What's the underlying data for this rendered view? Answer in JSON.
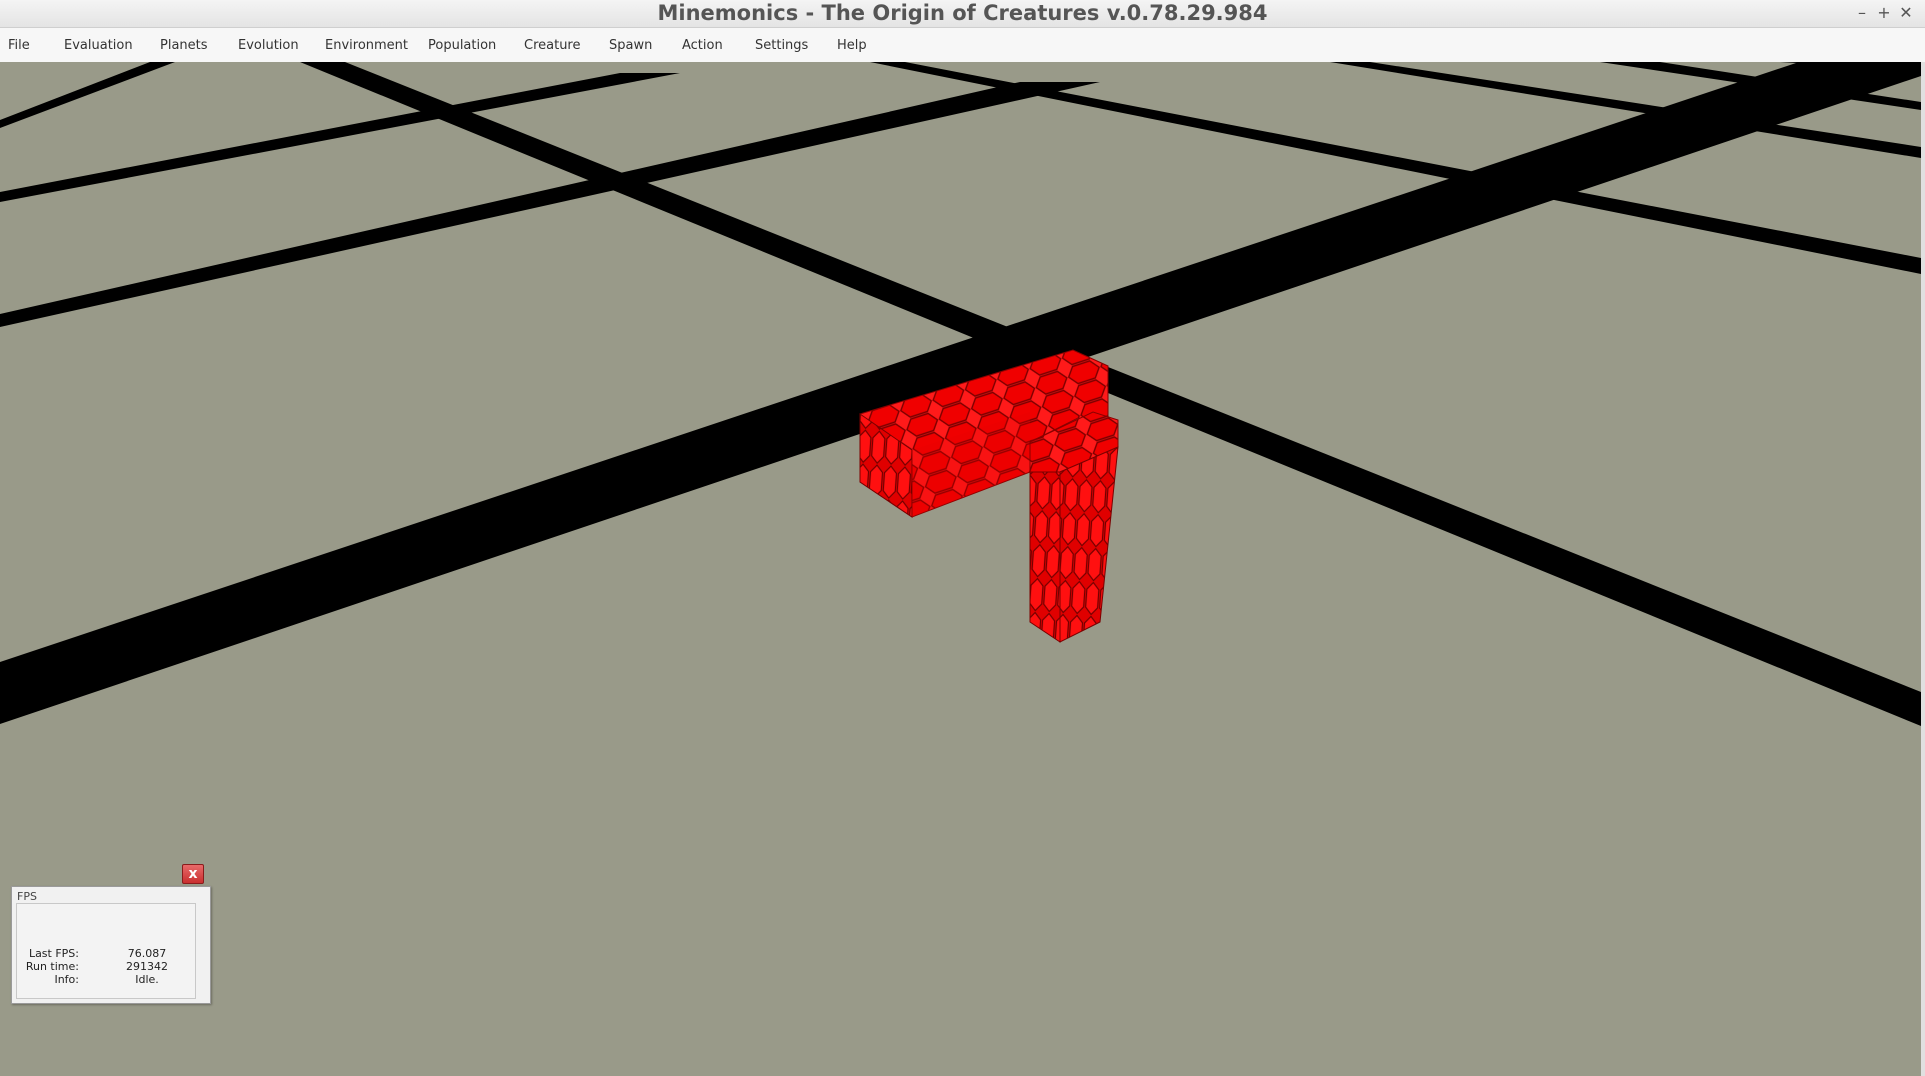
{
  "window": {
    "title": "Minemonics - The Origin of Creatures v.0.78.29.984",
    "minimize_glyph": "–",
    "maximize_glyph": "+",
    "close_glyph": "✕"
  },
  "menu": {
    "items": [
      {
        "label": "File"
      },
      {
        "label": "Evaluation"
      },
      {
        "label": "Planets"
      },
      {
        "label": "Evolution"
      },
      {
        "label": "Environment"
      },
      {
        "label": "Population"
      },
      {
        "label": "Creature"
      },
      {
        "label": "Spawn"
      },
      {
        "label": "Action"
      },
      {
        "label": "Settings"
      },
      {
        "label": "Help"
      }
    ]
  },
  "scene": {
    "ground_color": "#999a89",
    "grid_line_color": "#000000",
    "creature_color": "#ff1a1a",
    "creature_dark": "#b00000"
  },
  "fps_panel": {
    "title": "FPS",
    "close_glyph": "x",
    "rows": [
      {
        "label": "Last FPS:",
        "value": "76.087"
      },
      {
        "label": "Run time:",
        "value": "291342"
      },
      {
        "label": "Info:",
        "value": "Idle."
      }
    ]
  }
}
